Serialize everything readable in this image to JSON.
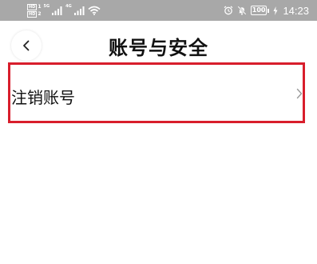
{
  "status_bar": {
    "sim1_badge": "HD",
    "sim1_slot": "1",
    "sim2_badge": "HD",
    "sim2_slot": "2",
    "sim1_network": "5G",
    "sim2_network": "4G",
    "battery": "100",
    "time": "14:23",
    "icons": [
      "signal-icon",
      "wifi-icon",
      "alarm-icon",
      "mute-icon",
      "battery-icon",
      "charging-icon"
    ]
  },
  "header": {
    "title": "账号与安全",
    "back_icon": "chevron-left-icon"
  },
  "list": {
    "items": [
      {
        "label": "注销账号",
        "icon": "chevron-right-icon"
      }
    ]
  },
  "colors": {
    "status_bar_bg": "#a8a8a8",
    "highlight_border": "#d81e2c",
    "text": "#111111",
    "chevron": "#9a9a9a"
  }
}
